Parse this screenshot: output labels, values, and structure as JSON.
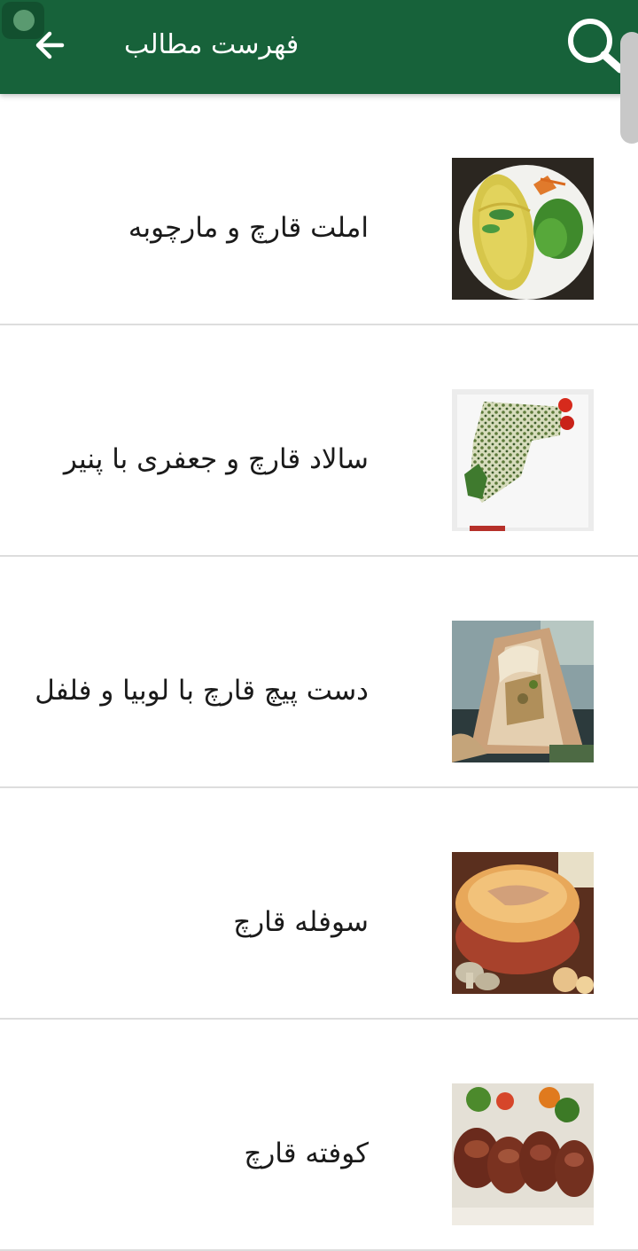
{
  "header": {
    "title": "فهرست مطالب",
    "back_icon": "arrow-left-icon",
    "search_icon": "search-icon",
    "background_color": "#17623a"
  },
  "recipes": [
    {
      "title": "املت قارچ و مارچوبه",
      "image": "omelette-image"
    },
    {
      "title": "سالاد قارچ و جعفری با پنیر",
      "image": "salad-image"
    },
    {
      "title": "دست پیچ قارچ با لوبیا و فلفل",
      "image": "wrap-image"
    },
    {
      "title": "سوفله قارچ",
      "image": "souffle-image"
    },
    {
      "title": "کوفته قارچ",
      "image": "meatball-image"
    }
  ]
}
